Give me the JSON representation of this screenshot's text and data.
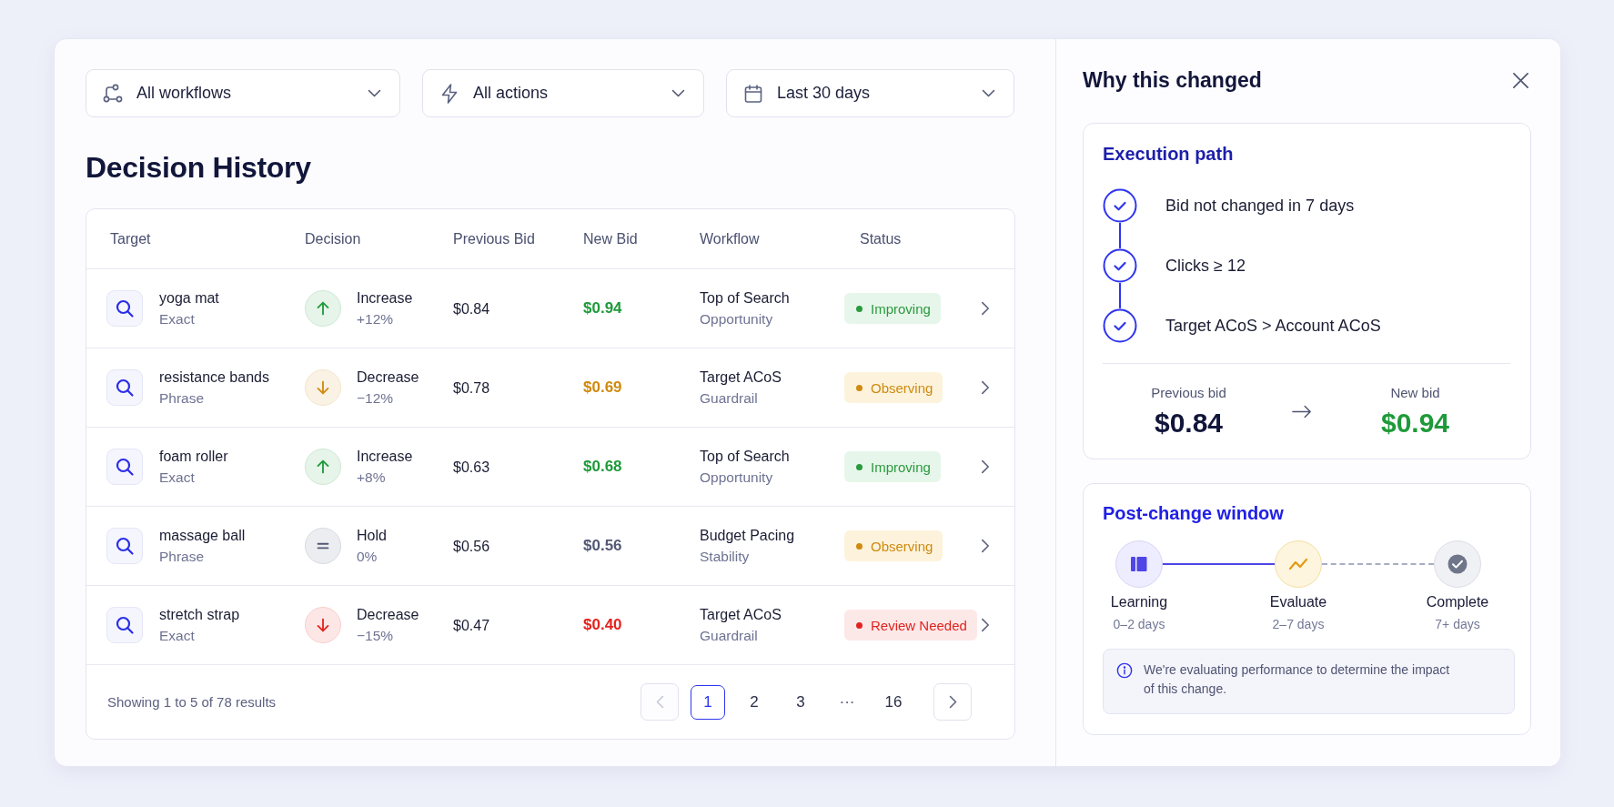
{
  "filters": [
    {
      "kind": "workflow",
      "value": "All workflows"
    },
    {
      "kind": "action",
      "value": "All actions"
    },
    {
      "kind": "date",
      "value": "Last 30 days"
    }
  ],
  "title": "Decision History",
  "table": {
    "columns": [
      "Target",
      "Decision",
      "Previous Bid",
      "New Bid",
      "Workflow",
      "Status"
    ],
    "rows": [
      {
        "target": "yoga mat",
        "match": "Exact",
        "decision": {
          "kind": "increase",
          "label": "Increase",
          "change": "+12%"
        },
        "color": "#1f9a3a",
        "previous_bid": "$0.84",
        "new_bid": "$0.94",
        "workflow": "Top of Search",
        "workflow_type": "Opportunity",
        "status": {
          "kind": "improving",
          "label": "Improving"
        }
      },
      {
        "target": "resistance bands",
        "match": "Phrase",
        "decision": {
          "kind": "decrease",
          "label": "Decrease",
          "change": "−12%"
        },
        "color": "#d08a0e",
        "previous_bid": "$0.78",
        "new_bid": "$0.69",
        "workflow": "Target ACoS",
        "workflow_type": "Guardrail",
        "status": {
          "kind": "observing",
          "label": "Observing"
        }
      },
      {
        "target": "foam roller",
        "match": "Exact",
        "decision": {
          "kind": "increase",
          "label": "Increase",
          "change": "+8%"
        },
        "color": "#1f9a3a",
        "previous_bid": "$0.63",
        "new_bid": "$0.68",
        "workflow": "Top of Search",
        "workflow_type": "Opportunity",
        "status": {
          "kind": "improving",
          "label": "Improving"
        }
      },
      {
        "target": "massage ball",
        "match": "Phrase",
        "decision": {
          "kind": "hold",
          "label": "Hold",
          "change": "0%"
        },
        "color": "#535975",
        "previous_bid": "$0.56",
        "new_bid": "$0.56",
        "workflow": "Budget Pacing",
        "workflow_type": "Stability",
        "status": {
          "kind": "observing",
          "label": "Observing"
        }
      },
      {
        "target": "stretch strap",
        "match": "Exact",
        "decision": {
          "kind": "decrease",
          "label": "Decrease",
          "change": "−15%"
        },
        "color": "#e5231f",
        "previous_bid": "$0.47",
        "new_bid": "$0.40",
        "workflow": "Target ACoS",
        "workflow_type": "Guardrail",
        "status": {
          "kind": "review",
          "label": "Review Needed"
        }
      }
    ]
  },
  "pagination": {
    "summary": "Showing 1 to 5 of 78 results",
    "prev": {
      "disabled": true
    },
    "next": {
      "disabled": false
    },
    "pages": [
      {
        "kind": "page",
        "label": "1",
        "selected": true
      },
      {
        "kind": "page",
        "label": "2",
        "selected": false
      },
      {
        "kind": "page",
        "label": "3",
        "selected": false
      },
      {
        "kind": "ellipsis",
        "label": "···",
        "selected": false
      },
      {
        "kind": "page",
        "label": "16",
        "selected": false
      }
    ]
  },
  "panel": {
    "title": "Why this changed",
    "execution_path": {
      "title": "Execution path",
      "steps": [
        {
          "label": "Bid not changed in 7 days",
          "checked": true
        },
        {
          "label": "Clicks ≥ 12",
          "checked": true
        },
        {
          "label": "Target ACoS > Account ACoS",
          "checked": true
        }
      ],
      "previous_label": "Previous bid",
      "previous_value": "$0.84",
      "new_label": "New bid",
      "new_value": "$0.94"
    },
    "post_change": {
      "title": "Post-change window",
      "stages": [
        {
          "kind": "learning",
          "reached": true,
          "label": "Learning",
          "duration": "0–2 days"
        },
        {
          "kind": "evaluate",
          "reached": true,
          "label": "Evaluate",
          "duration": "2–7 days"
        },
        {
          "kind": "complete",
          "reached": false,
          "label": "Complete",
          "duration": "7+ days"
        }
      ],
      "note": "We're evaluating performance to determine the impact of this change."
    }
  }
}
